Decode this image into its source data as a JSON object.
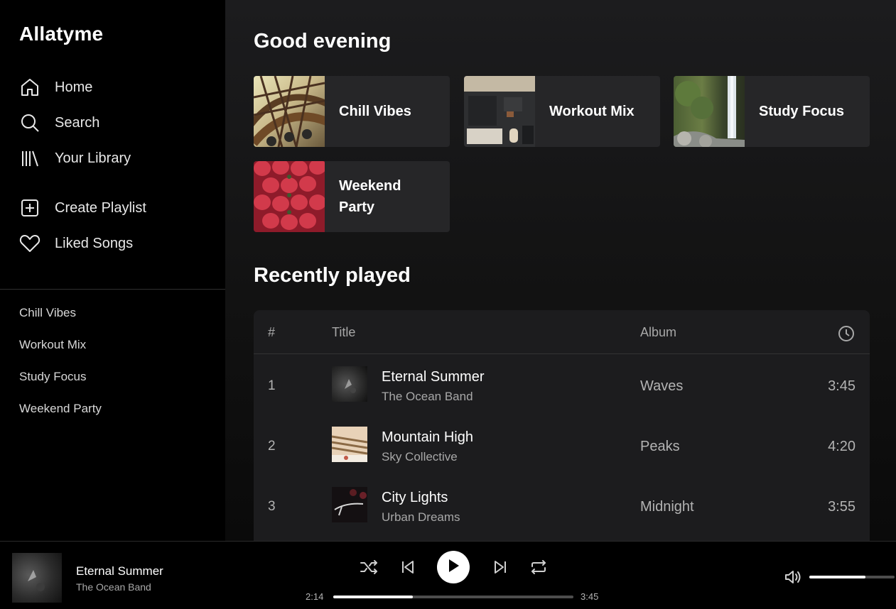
{
  "app": {
    "brand": "Allatyme"
  },
  "sidebar": {
    "nav": [
      {
        "label": "Home",
        "icon": "home-icon"
      },
      {
        "label": "Search",
        "icon": "search-icon"
      },
      {
        "label": "Your Library",
        "icon": "library-icon"
      }
    ],
    "actions": [
      {
        "label": "Create Playlist",
        "icon": "plus-square-icon"
      },
      {
        "label": "Liked Songs",
        "icon": "heart-icon"
      }
    ],
    "playlists": [
      "Chill Vibes",
      "Workout Mix",
      "Study Focus",
      "Weekend Party"
    ]
  },
  "main": {
    "greeting": "Good evening",
    "cards": [
      {
        "title": "Chill Vibes"
      },
      {
        "title": "Workout Mix"
      },
      {
        "title": "Study Focus"
      },
      {
        "title": "Weekend Party"
      }
    ],
    "recent_heading": "Recently played",
    "table": {
      "headers": {
        "num": "#",
        "title": "Title",
        "album": "Album",
        "duration_icon": "clock-icon"
      },
      "rows": [
        {
          "num": "1",
          "title": "Eternal Summer",
          "artist": "The Ocean Band",
          "album": "Waves",
          "duration": "3:45"
        },
        {
          "num": "2",
          "title": "Mountain High",
          "artist": "Sky Collective",
          "album": "Peaks",
          "duration": "4:20"
        },
        {
          "num": "3",
          "title": "City Lights",
          "artist": "Urban Dreams",
          "album": "Midnight",
          "duration": "3:55"
        }
      ]
    }
  },
  "player": {
    "title": "Eternal Summer",
    "artist": "The Ocean Band",
    "elapsed": "2:14",
    "total": "3:45",
    "progress_fraction": 0.33,
    "volume_fraction": 0.66,
    "controls": [
      "shuffle-icon",
      "previous-icon",
      "play-icon",
      "next-icon",
      "repeat-icon",
      "volume-icon"
    ]
  },
  "colors": {
    "background": "#000000",
    "panel": "#1c1c1e",
    "card": "#262628",
    "text_muted": "#a8a8a8"
  }
}
